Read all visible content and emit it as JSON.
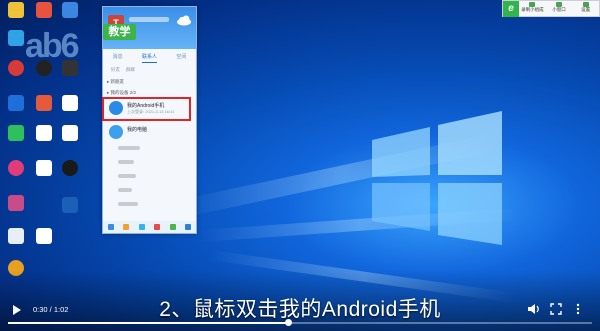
{
  "video": {
    "subtitle": "2、鼠标双击我的Android手机",
    "time": "0:30 / 1:02",
    "progress": 0.48
  },
  "badge": {
    "label": "教学"
  },
  "recorder": {
    "logo": "e",
    "items": [
      "录制小组成",
      "小窗口",
      "设置"
    ]
  },
  "qq": {
    "avatar": "T",
    "tabs": [
      "消息",
      "联系人",
      "空间"
    ],
    "subtabs": [
      "好友",
      "群聊"
    ],
    "groups": [
      "▸ 新朋友",
      "▸ 我的设备 2/2"
    ],
    "devices": [
      {
        "name": "我的Android手机",
        "sub": "上次登录: 2021-4-13 16:41"
      },
      {
        "name": "我的电脑",
        "sub": ""
      }
    ]
  }
}
